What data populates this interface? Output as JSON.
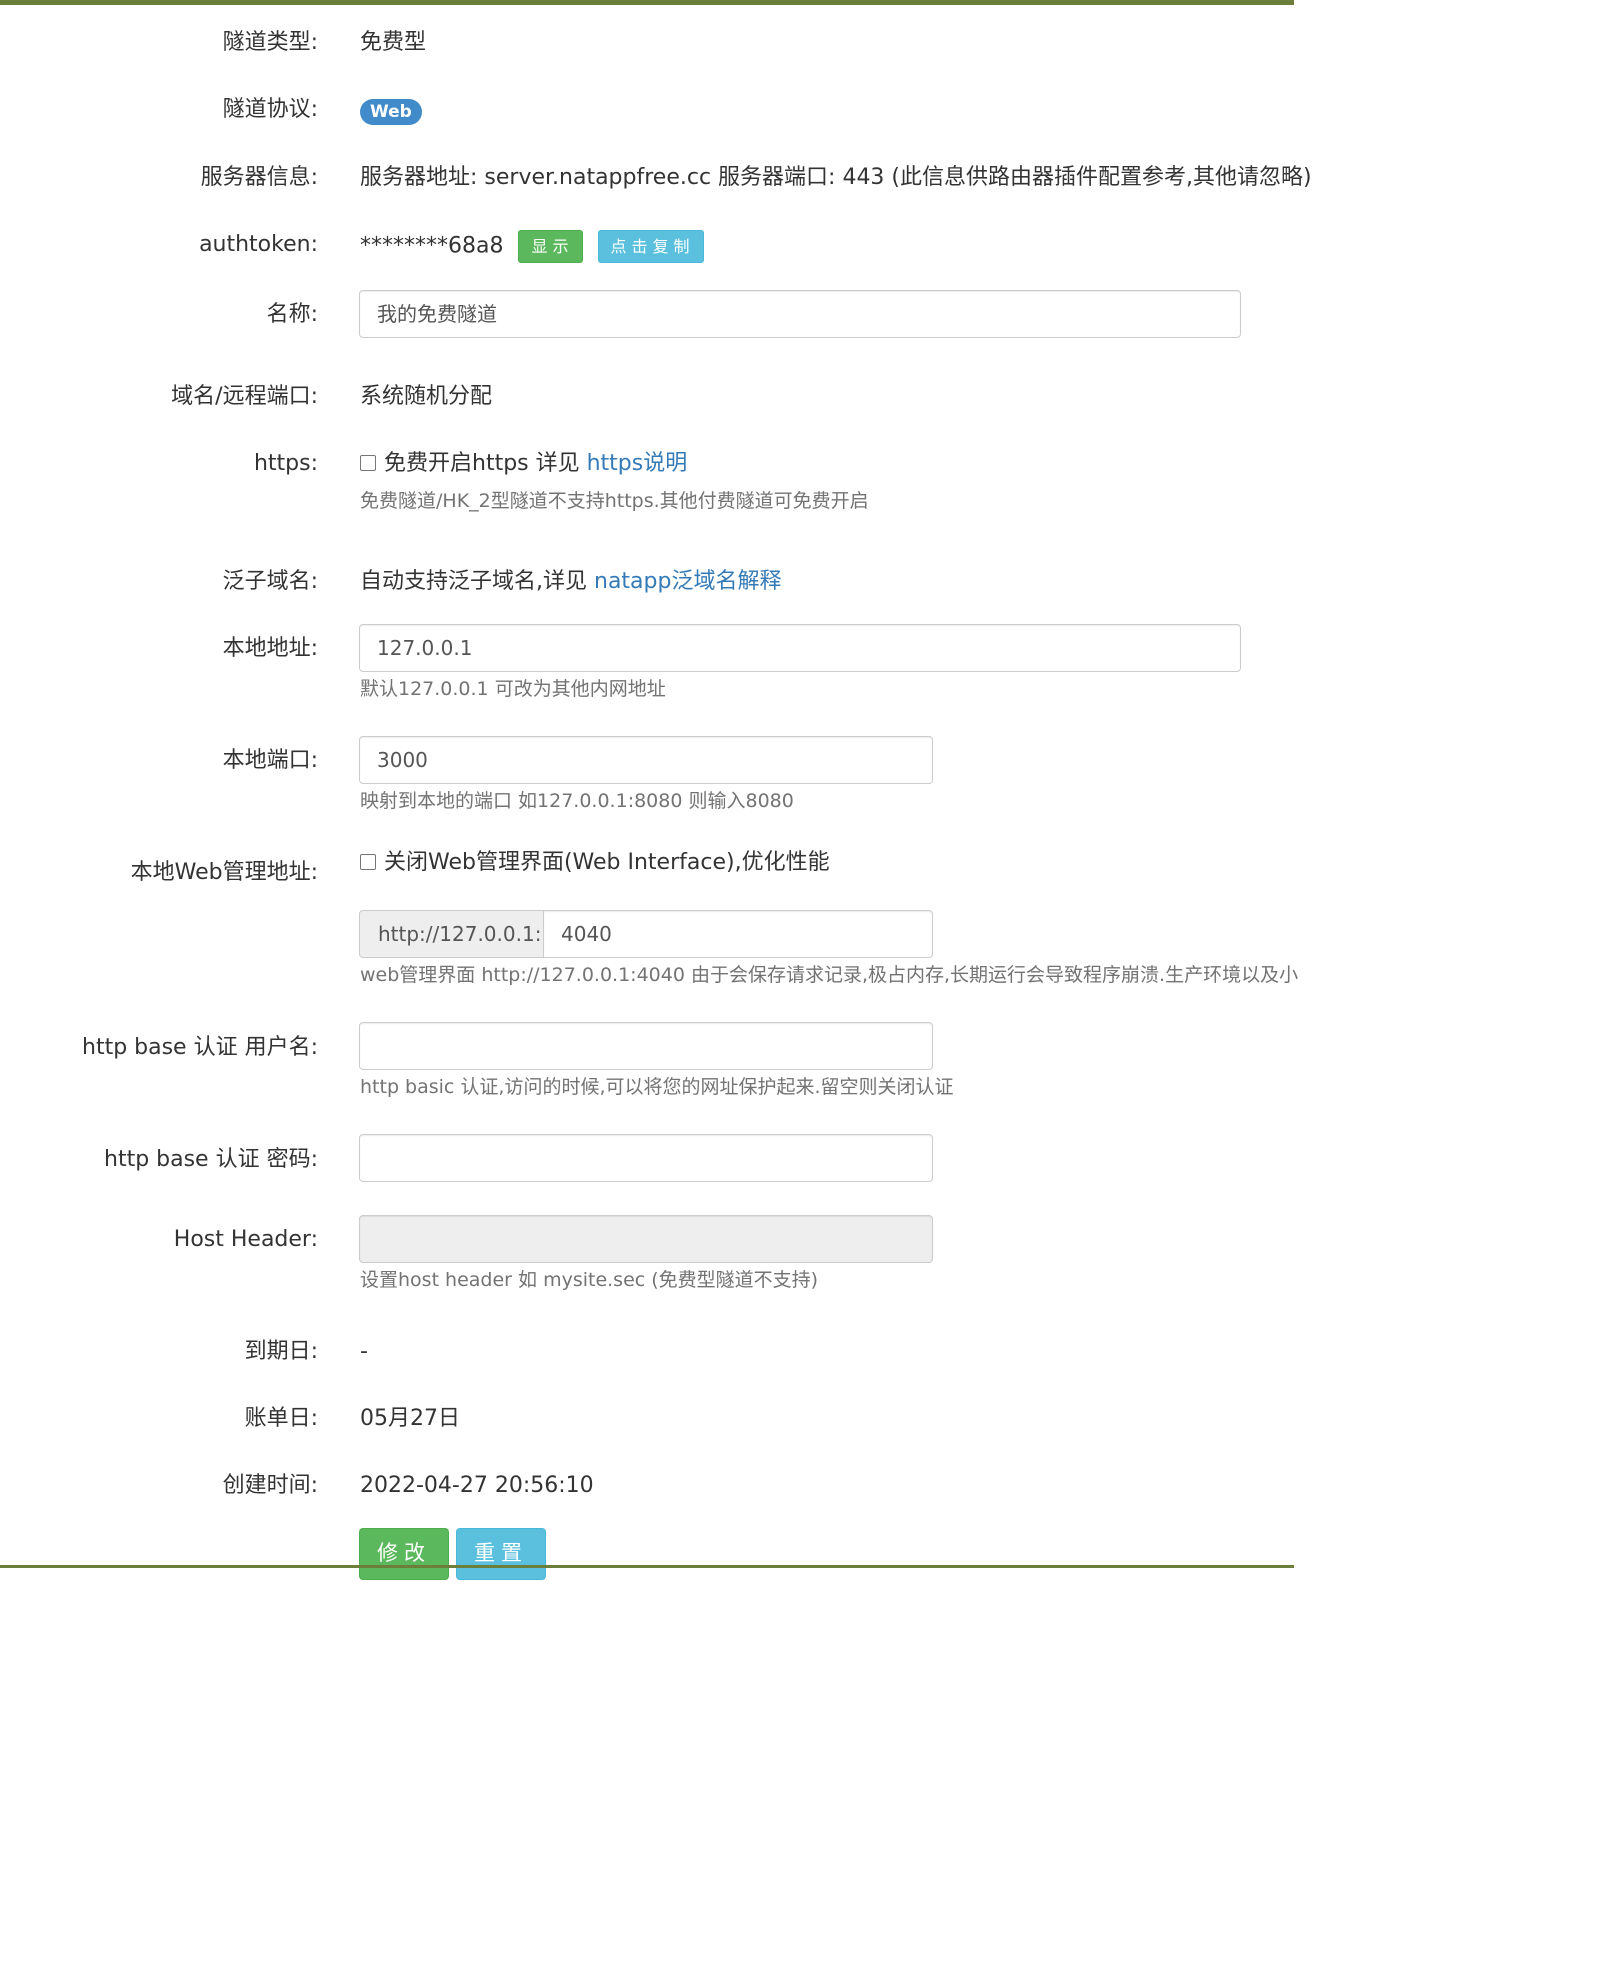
{
  "tunnel_type": {
    "label": "隧道类型:",
    "value": "免费型"
  },
  "protocol": {
    "label": "隧道协议:",
    "badge": "Web"
  },
  "server_info": {
    "label": "服务器信息:",
    "value": "服务器地址: server.natappfree.cc 服务器端口: 443 (此信息供路由器插件配置参考,其他请忽略)"
  },
  "authtoken": {
    "label": "authtoken:",
    "value": "********68a8",
    "show_button": "显示",
    "copy_button": "点击复制"
  },
  "name": {
    "label": "名称:",
    "value": "我的免费隧道"
  },
  "domain_port": {
    "label": "域名/远程端口:",
    "value": "系统随机分配"
  },
  "https": {
    "label": "https:",
    "checkbox_text": "免费开启https 详见 ",
    "link": "https说明",
    "help": "免费隧道/HK_2型隧道不支持https.其他付费隧道可免费开启"
  },
  "wildcard": {
    "label": "泛子域名:",
    "text": "自动支持泛子域名,详见 ",
    "link": "natapp泛域名解释"
  },
  "local_address": {
    "label": "本地地址:",
    "value": "127.0.0.1",
    "help": "默认127.0.0.1 可改为其他内网地址"
  },
  "local_port": {
    "label": "本地端口:",
    "value": "3000",
    "help": "映射到本地的端口 如127.0.0.1:8080 则输入8080"
  },
  "web_admin": {
    "label": "本地Web管理地址:",
    "checkbox_text": "关闭Web管理界面(Web Interface),优化性能",
    "prefix": "http://127.0.0.1:",
    "port": "4040",
    "help": "web管理界面 http://127.0.0.1:4040 由于会保存请求记录,极占内存,长期运行会导致程序崩溃.生产环境以及小"
  },
  "basic_user": {
    "label": "http base 认证 用户名:",
    "value": "",
    "help": "http basic 认证,访问的时候,可以将您的网址保护起来.留空则关闭认证"
  },
  "basic_pass": {
    "label": "http base 认证 密码:",
    "value": ""
  },
  "host_header": {
    "label": "Host Header:",
    "value": "",
    "help": "设置host header 如 mysite.sec (免费型隧道不支持)"
  },
  "expiry": {
    "label": "到期日:",
    "value": "-"
  },
  "billing": {
    "label": "账单日:",
    "value": "05月27日"
  },
  "created": {
    "label": "创建时间:",
    "value": "2022-04-27 20:56:10"
  },
  "actions": {
    "modify": "修改",
    "reset": "重置"
  }
}
